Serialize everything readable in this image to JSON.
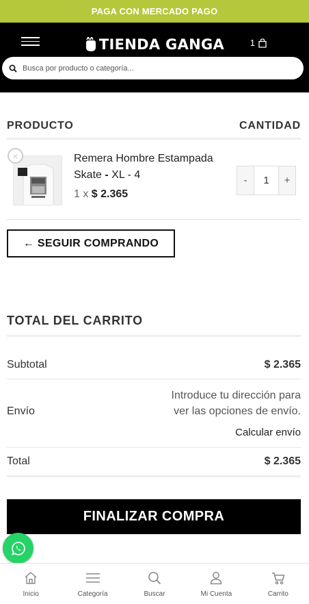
{
  "promo": {
    "text": "PAGA CON MERCADO PAGO"
  },
  "header": {
    "logo_text": "TIENDA GANGA",
    "cart_count": "1",
    "search_placeholder": "Busca por producto o categoría..."
  },
  "cart": {
    "col_product": "PRODUCTO",
    "col_quantity": "CANTIDAD",
    "items": [
      {
        "name": "Remera Hombre Estampada Skate",
        "variant_sep": " - ",
        "variant": "XL - 4",
        "qty_prefix": "1 x",
        "price": "$ 2.365",
        "quantity": "1",
        "minus": "-",
        "plus": "+"
      }
    ],
    "continue_label": "← SEGUIR COMPRANDO"
  },
  "totals": {
    "title": "TOTAL DEL CARRITO",
    "subtotal_label": "Subtotal",
    "subtotal_value": "$ 2.365",
    "shipping_label": "Envío",
    "shipping_info": "Introduce tu dirección para ver las opciones de envío.",
    "shipping_calc": "Calcular envío",
    "total_label": "Total",
    "total_value": "$ 2.365"
  },
  "checkout_label": "FINALIZAR COMPRA",
  "bottom_nav": [
    {
      "label": "Inicio",
      "icon": "home-icon"
    },
    {
      "label": "Categoría",
      "icon": "menu-icon"
    },
    {
      "label": "Buscar",
      "icon": "search-icon"
    },
    {
      "label": "Mi Cuenta",
      "icon": "user-icon"
    },
    {
      "label": "Carrito",
      "icon": "cart-icon"
    }
  ],
  "colors": {
    "promo": "#b5c83c",
    "header": "#000000",
    "whatsapp": "#25d366"
  }
}
